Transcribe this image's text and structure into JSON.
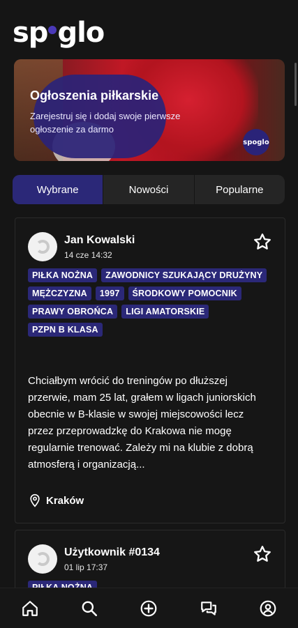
{
  "app": {
    "logo_text_pre": "sp",
    "logo_text_post": "glo"
  },
  "banner": {
    "title": "Ogłoszenia piłkarskie",
    "subtitle": "Zarejestruj się i dodaj swoje pierwsze ogłoszenie za darmo",
    "badge": "spoglo"
  },
  "tabs": [
    {
      "label": "Wybrane",
      "active": true
    },
    {
      "label": "Nowości",
      "active": false
    },
    {
      "label": "Popularne",
      "active": false
    }
  ],
  "posts": [
    {
      "author": "Jan Kowalski",
      "date": "14 cze 14:32",
      "tags": [
        "PIŁKA NOŻNA",
        "ZAWODNICY SZUKAJĄCY DRUŻYNY",
        "MĘŻCZYZNA",
        "1997",
        "ŚRODKOWY POMOCNIK",
        "PRAWY OBROŃCA",
        "LIGI AMATORSKIE",
        "PZPN B KLASA"
      ],
      "description": "Chciałbym wrócić do treningów po dłuższej przerwie, mam 25 lat, grałem w ligach juniorskich obecnie w B-klasie w swojej miejscowości lecz przez przeprowadzkę do Krakowa nie mogę regularnie trenować. Zależy mi na klubie z dobrą atmosferą i organizacją...",
      "location": "Kraków"
    },
    {
      "author": "Użytkownik #0134",
      "date": "01 lip 17:37",
      "tags": [
        "PIŁKA NOŻNA"
      ]
    }
  ],
  "colors": {
    "accent": "#2b2878",
    "background": "#151515",
    "card_border": "#2b2b2b"
  },
  "nav": [
    "home-icon",
    "search-icon",
    "add-icon",
    "chat-icon",
    "profile-icon"
  ]
}
